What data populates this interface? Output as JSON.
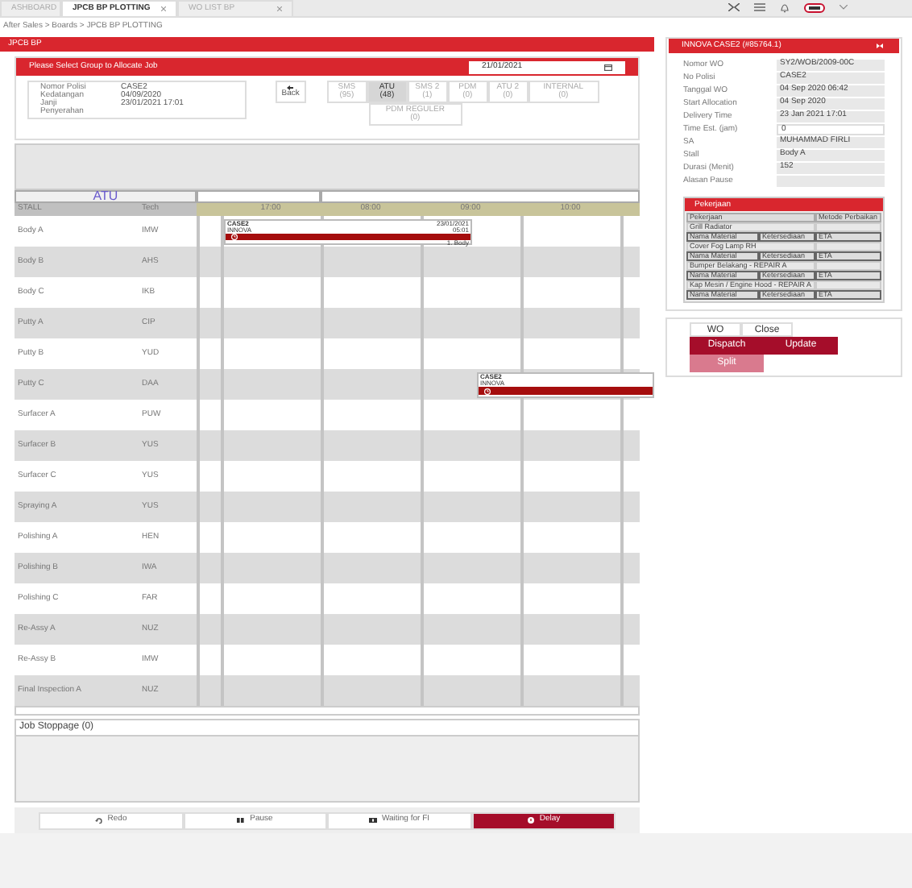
{
  "tabs": [
    {
      "label": "ASHBOARD",
      "selected": false,
      "closable": false
    },
    {
      "label": "JPCB BP PLOTTING",
      "selected": true,
      "closable": true
    },
    {
      "label": "WO LIST BP",
      "selected": false,
      "closable": true
    }
  ],
  "breadcrumb": "After Sales > Boards > JPCB BP PLOTTING",
  "panel_title": "JPCB BP",
  "allocate": {
    "title": "Please Select Group to Allocate Job",
    "date": "21/01/2021"
  },
  "vehicle_info": [
    {
      "label": "Nomor Polisi",
      "value": "CASE2"
    },
    {
      "label": "Kedatangan",
      "value": "04/09/2020"
    },
    {
      "label": "Janji Penyerahan",
      "value": "23/01/2021 17:01"
    }
  ],
  "back_button": "Back",
  "groups": [
    {
      "label": "SMS",
      "count": "(95)",
      "selected": false
    },
    {
      "label": "ATU",
      "count": "(48)",
      "selected": true
    },
    {
      "label": "SMS 2",
      "count": "(1)",
      "selected": false
    },
    {
      "label": "PDM",
      "count": "(0)",
      "selected": false
    },
    {
      "label": "ATU 2",
      "count": "(0)",
      "selected": false
    },
    {
      "label": "INTERNAL",
      "count": "(0)",
      "selected": false
    },
    {
      "label": "PDM REGULER",
      "count": "(0)",
      "selected": false
    }
  ],
  "board": {
    "group_title": "ATU",
    "stall_header": "STALL",
    "tech_header": "Tech",
    "times": [
      "17:00",
      "08:00",
      "09:00",
      "10:00"
    ],
    "rows": [
      {
        "stall": "Body A",
        "tech": "IMW",
        "jobs": [
          {
            "title": "CASE2",
            "model": "INNOVA",
            "date": "23/01/2021",
            "time": "05:01",
            "note": "1. Body"
          }
        ]
      },
      {
        "stall": "Body B",
        "tech": "AHS"
      },
      {
        "stall": "Body C",
        "tech": "IKB"
      },
      {
        "stall": "Putty A",
        "tech": "CIP"
      },
      {
        "stall": "Putty B",
        "tech": "YUD"
      },
      {
        "stall": "Putty C",
        "tech": "DAA",
        "jobs": [
          {
            "title": "CASE2",
            "model": "INNOVA"
          }
        ]
      },
      {
        "stall": "Surfacer A",
        "tech": "PUW"
      },
      {
        "stall": "Surfacer B",
        "tech": "YUS"
      },
      {
        "stall": "Surfacer C",
        "tech": "YUS"
      },
      {
        "stall": "Spraying A",
        "tech": "YUS"
      },
      {
        "stall": "Polishing A",
        "tech": "HEN"
      },
      {
        "stall": "Polishing B",
        "tech": "IWA"
      },
      {
        "stall": "Polishing C",
        "tech": "FAR"
      },
      {
        "stall": "Re-Assy A",
        "tech": "NUZ"
      },
      {
        "stall": "Re-Assy B",
        "tech": "IMW"
      },
      {
        "stall": "Final Inspection A",
        "tech": "NUZ"
      }
    ]
  },
  "job_stoppage": {
    "title": "Job Stoppage (0)"
  },
  "actions": [
    {
      "label": "Redo",
      "kind": "redo"
    },
    {
      "label": "Pause",
      "kind": "pause"
    },
    {
      "label": "Waiting for FI",
      "kind": "wait"
    },
    {
      "label": "Delay",
      "kind": "delay"
    }
  ],
  "detail": {
    "title": "INNOVA CASE2 (#85764.1)",
    "fields": [
      {
        "label": "Nomor WO",
        "value": "SY2/WOB/2009-00C"
      },
      {
        "label": "No Polisi",
        "value": "CASE2"
      },
      {
        "label": "Tanggal WO",
        "value": "04 Sep 2020 06:42"
      },
      {
        "label": "Start Allocation",
        "value": "04 Sep 2020"
      },
      {
        "label": "Delivery Time",
        "value": "23 Jan 2021 17:01"
      },
      {
        "label": "Time Est. (jam)",
        "value": "0",
        "editable": true
      },
      {
        "label": "SA",
        "value": "MUHAMMAD FIRLI"
      },
      {
        "label": "Stall",
        "value": "Body A"
      },
      {
        "label": "Durasi (Menit)",
        "value": "152"
      },
      {
        "label": "Alasan Pause"
      }
    ],
    "work": {
      "title": "Pekerjaan",
      "columns": [
        "Pekerjaan",
        "Metode Perbaikan"
      ],
      "items": [
        {
          "name": "Grill Radiator",
          "material_columns": [
            "Nama Material",
            "Ketersediaan",
            "ETA"
          ]
        },
        {
          "name": "Cover Fog Lamp RH",
          "material_columns": [
            "Nama Material",
            "Ketersediaan",
            "ETA"
          ]
        },
        {
          "name": "Bumper Belakang - REPAIR A",
          "material_columns": [
            "Nama Material",
            "Ketersediaan",
            "ETA"
          ]
        },
        {
          "name": "Kap Mesin / Engine Hood - REPAIR A",
          "material_columns": [
            "Nama Material",
            "Ketersediaan",
            "ETA"
          ]
        }
      ]
    },
    "tabs": [
      {
        "label": "WO"
      },
      {
        "label": "Close"
      }
    ],
    "buttons": [
      {
        "label": "Dispatch",
        "kind": "primary"
      },
      {
        "label": "Update",
        "kind": "primary"
      },
      {
        "label": "Split",
        "kind": "light"
      }
    ]
  }
}
